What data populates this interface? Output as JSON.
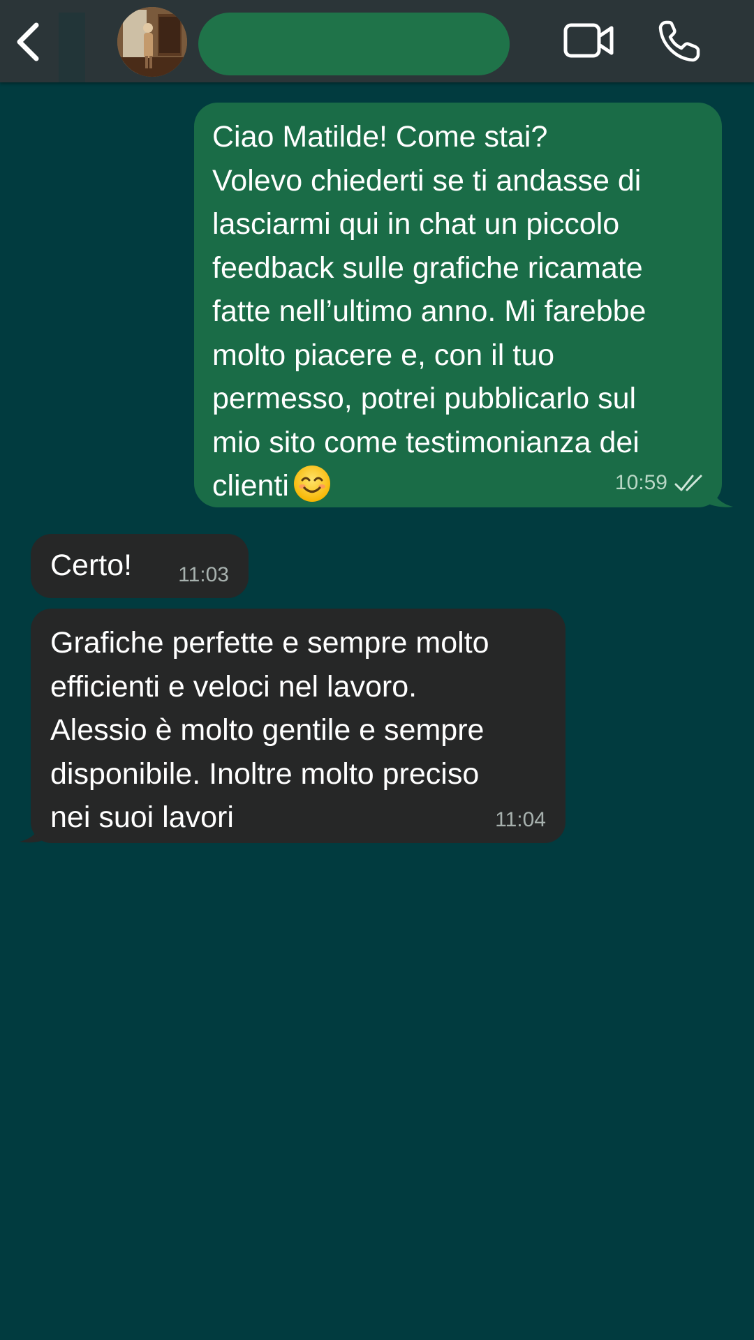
{
  "header": {
    "back_icon": "chevron-left-icon",
    "video_icon": "video-camera-icon",
    "call_icon": "phone-icon",
    "avatar": "contact-avatar-photo",
    "name_redacted": true
  },
  "messages": [
    {
      "direction": "outgoing",
      "text_lines": [
        "Ciao Matilde! Come stai?",
        "Volevo chiederti se ti andasse di",
        "lasciarmi qui in chat un piccolo",
        "feedback sulle grafiche ricamate",
        "fatte nell’ultimo anno. Mi farebbe",
        "molto piacere e, con il tuo",
        "permesso, potrei pubblicarlo sul",
        "mio sito come testimonianza dei",
        "clienti"
      ],
      "emoji": "smiling-face-icon",
      "time": "10:59",
      "status_icon": "double-check-icon"
    },
    {
      "direction": "incoming",
      "text": "Certo!",
      "time": "11:03"
    },
    {
      "direction": "incoming",
      "text_lines": [
        "Grafiche perfette e sempre molto",
        "efficienti e veloci nel lavoro.",
        "Alessio è molto gentile e sempre",
        "disponibile. Inoltre molto preciso",
        "nei suoi lavori"
      ],
      "time": "11:04"
    }
  ],
  "colors": {
    "chat_background": "#013b3f",
    "header_background": "#2b3538",
    "outgoing_bubble": "#1a6c47",
    "incoming_bubble": "#262727",
    "redaction": "#1f7349"
  }
}
